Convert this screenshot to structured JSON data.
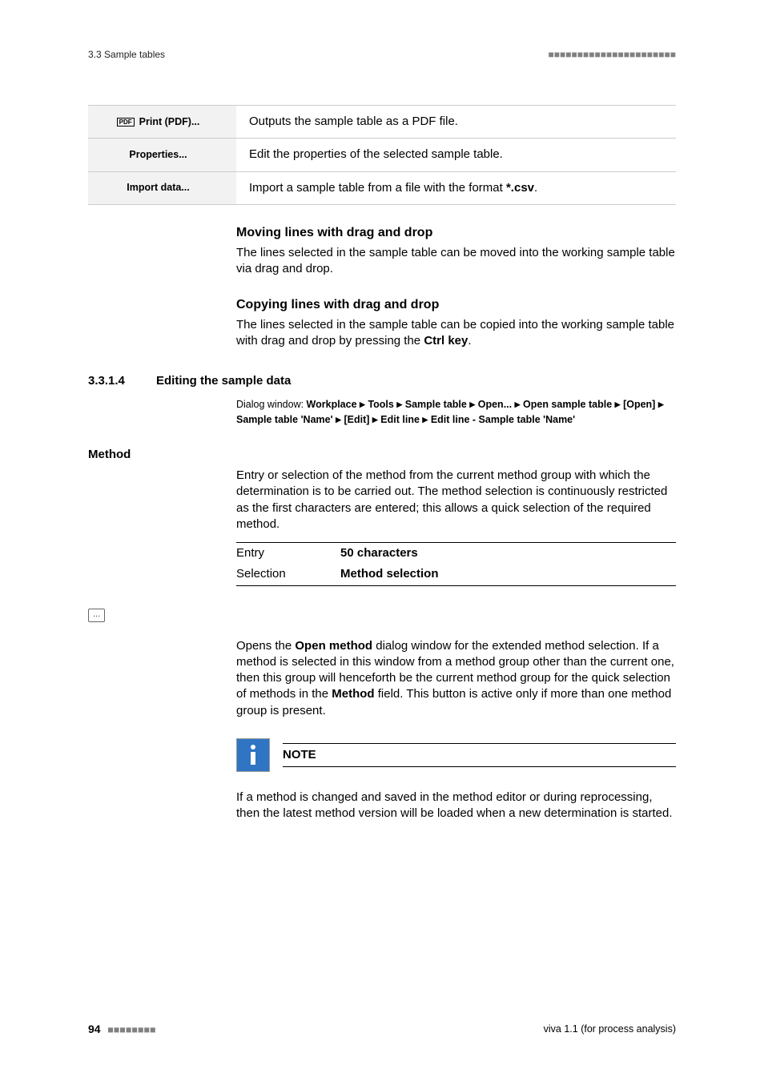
{
  "header": {
    "breadcrumb": "3.3 Sample tables",
    "dashes": "■■■■■■■■■■■■■■■■■■■■■■"
  },
  "table": {
    "rows": [
      {
        "icon": "pdf",
        "label": "Print (PDF)...",
        "desc": "Outputs the sample table as a PDF file."
      },
      {
        "icon": "",
        "label": "Properties...",
        "desc": "Edit the properties of the selected sample table."
      },
      {
        "icon": "",
        "label": "Import data...",
        "desc_pre": "Import a sample table from a file with the format ",
        "desc_bold": "*.csv",
        "desc_post": "."
      }
    ]
  },
  "moving": {
    "title": "Moving lines with drag and drop",
    "text": "The lines selected in the sample table can be moved into the working sample table via drag and drop."
  },
  "copying": {
    "title": "Copying lines with drag and drop",
    "text_pre": "The lines selected in the sample table can be copied into the working sam­ple table with drag and drop by pressing the ",
    "text_bold": "Ctrl key",
    "text_post": "."
  },
  "section": {
    "num": "3.3.1.4",
    "title": "Editing the sample data",
    "dlg_label": "Dialog window: ",
    "dlg_parts": [
      "Workplace",
      "Tools",
      "Sample table",
      "Open...",
      "Open sample table",
      "[Open]",
      "Sample table 'Name'",
      "[Edit]",
      "Edit line",
      "Edit line - Sample table 'Name'"
    ]
  },
  "method": {
    "label": "Method",
    "para": "Entry or selection of the method from the current method group with which the determination is to be carried out. The method selection is con­tinuously restricted as the first characters are entered; this allows a quick selection of the required method.",
    "spec": [
      {
        "k": "Entry",
        "v": "50 characters"
      },
      {
        "k": "Selection",
        "v": "Method selection"
      }
    ]
  },
  "ellipsis": "...",
  "open_method": {
    "pre": "Opens the ",
    "bold1": "Open method",
    "mid": " dialog window for the extended method selec­tion. If a method is selected in this window from a method group other than the current one, then this group will henceforth be the current method group for the quick selection of methods in the ",
    "bold2": "Method",
    "post": " field. This button is active only if more than one method group is present."
  },
  "note": {
    "title": "NOTE",
    "text": "If a method is changed and saved in the method editor or during repro­cessing, then the latest method version will be loaded when a new determination is started."
  },
  "footer": {
    "page": "94",
    "dashes": "■■■■■■■■",
    "product": "viva 1.1 (for process analysis)"
  }
}
